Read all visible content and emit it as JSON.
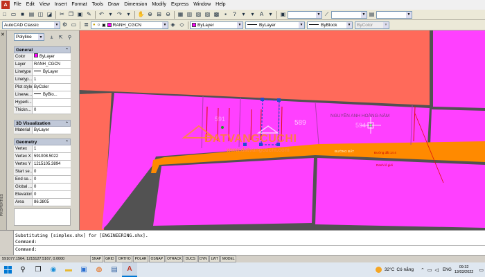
{
  "app": {
    "icon_letter": "A"
  },
  "menu": [
    "File",
    "Edit",
    "View",
    "Insert",
    "Format",
    "Tools",
    "Draw",
    "Dimension",
    "Modify",
    "Express",
    "Window",
    "Help"
  ],
  "toolbar2": {
    "workspace": "AutoCAD Classic",
    "layer": "RANH_CGCN",
    "color": "ByLayer",
    "linetype": "ByLayer",
    "lineweight": "ByBlock",
    "plotstyle": "ByColor"
  },
  "palette": {
    "object_type": "Polyline",
    "vertical_title": "PROPERTIES",
    "general": {
      "title": "General",
      "rows": [
        {
          "k": "Color",
          "v": "ByLayer"
        },
        {
          "k": "Layer",
          "v": "RANH_CGCN"
        },
        {
          "k": "Linetype",
          "v": "ByLayer"
        },
        {
          "k": "Linetyp...",
          "v": "1"
        },
        {
          "k": "Plot style",
          "v": "ByColor"
        },
        {
          "k": "Linewe...",
          "v": "ByBlo..."
        },
        {
          "k": "Hyperli...",
          "v": ""
        },
        {
          "k": "Thickn...",
          "v": "0"
        }
      ]
    },
    "viz": {
      "title": "3D Visualization",
      "rows": [
        {
          "k": "Material",
          "v": "ByLayer"
        }
      ]
    },
    "geometry": {
      "title": "Geometry",
      "rows": [
        {
          "k": "Vertex",
          "v": "1"
        },
        {
          "k": "Vertex X",
          "v": "591008.5022"
        },
        {
          "k": "Vertex Y",
          "v": "1215105.3894"
        },
        {
          "k": "Start se...",
          "v": "0"
        },
        {
          "k": "End se...",
          "v": "0"
        },
        {
          "k": "Global ...",
          "v": "0"
        },
        {
          "k": "Elevation",
          "v": "0"
        },
        {
          "k": "Area",
          "v": "86.3805"
        }
      ]
    }
  },
  "canvas": {
    "watermark": "DATVANGCUCHI",
    "watermark_url": "www.datvangcuchi.com",
    "owner_name": "NGUYỄN ANH HOÀNG-NĂM",
    "road_label_1": "ĐƯỜNG ĐẤT",
    "road_label_2": "Đường đất 14 4",
    "ranh_label": "Ranh lô giới",
    "plot_589": "589",
    "plot_591": "591",
    "plot_594": "594"
  },
  "command": {
    "line1": "Substituting [simplex.shx] for [ENGINEERING.shx].",
    "line2": "Command:",
    "line3": "Command:"
  },
  "status": {
    "coords": "591077.1564, 1215127.5167, 0.0000",
    "modes": [
      "SNAP",
      "GRID",
      "ORTHO",
      "POLAR",
      "OSNAP",
      "OTRACK",
      "DUCS",
      "DYN",
      "LWT",
      "MODEL"
    ]
  },
  "taskbar": {
    "temperature": "32°C",
    "weather": "Có nắng",
    "language": "ENG",
    "time": "09:32",
    "date": "13/03/2022"
  },
  "colors": {
    "parcel_magenta": "#ff40ff",
    "parcel_red": "#ff6a5a",
    "road_orange": "#ff8a00",
    "background": "#525252"
  }
}
